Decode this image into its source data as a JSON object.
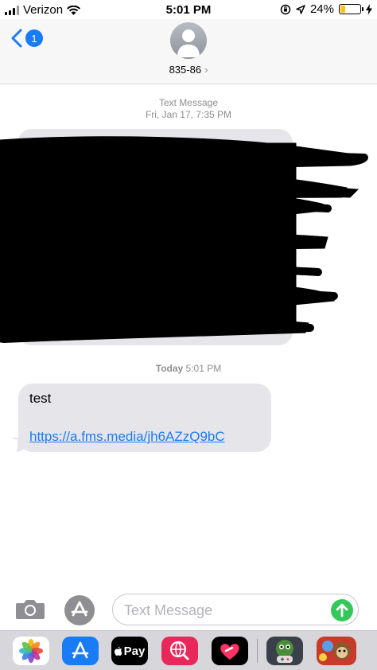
{
  "status_bar": {
    "carrier": "Verizon",
    "time": "5:01 PM",
    "battery_percent": "24%",
    "battery_level": 0.24,
    "icons": [
      "signal-bars-icon",
      "wifi-icon",
      "orientation-lock-icon",
      "location-arrow-icon",
      "battery-icon",
      "charging-bolt-icon"
    ]
  },
  "header": {
    "back_badge_count": "1",
    "contact_name": "835-86",
    "contact_chevron": "›"
  },
  "conversation": {
    "first_timestamp": {
      "label": "Text Message",
      "date": "Fri, Jan 17, 7:35 PM"
    },
    "second_timestamp": {
      "day": "Today",
      "time": "5:01 PM"
    },
    "messages": [
      {
        "text": "test",
        "link": "https://a.fms.media/jh6AZzQ9bC"
      }
    ]
  },
  "composer": {
    "placeholder": "Text Message"
  },
  "app_drawer": {
    "items": [
      {
        "name": "Photos"
      },
      {
        "name": "App Store"
      },
      {
        "name": "Apple Pay",
        "label": "Pay"
      },
      {
        "name": "Search Images"
      },
      {
        "name": "Digital Touch"
      },
      {
        "name": "Game App"
      },
      {
        "name": "Bloons Game"
      }
    ]
  },
  "colors": {
    "accent_blue": "#1a7cf5",
    "bubble_gray": "#e5e5ea",
    "send_green": "#34c759",
    "battery_yellow": "#f5c518"
  }
}
